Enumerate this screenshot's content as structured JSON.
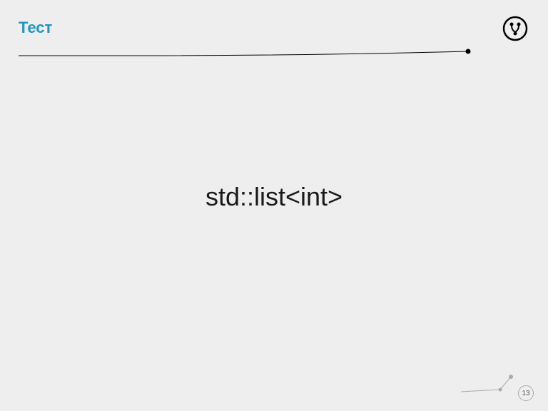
{
  "header": {
    "title": "Тест"
  },
  "main": {
    "text": "std::list<int>"
  },
  "footer": {
    "page_number": "13"
  }
}
